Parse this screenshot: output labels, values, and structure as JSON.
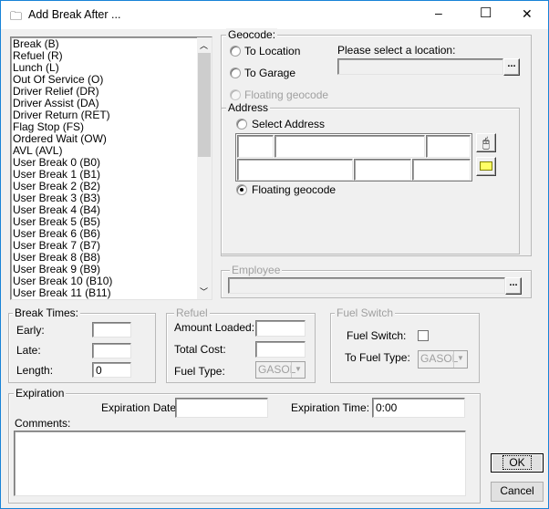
{
  "window": {
    "title": "Add Break After ...",
    "icon": "folder-window-icon",
    "minimize": "–",
    "maximize": "☐",
    "close": "✕"
  },
  "break_list": {
    "items": [
      "Break (B)",
      "Refuel (R)",
      "Lunch (L)",
      "Out Of Service (O)",
      "Driver Relief (DR)",
      "Driver Assist (DA)",
      "Driver Return (RET)",
      "Flag Stop (FS)",
      "Ordered Wait (OW)",
      "AVL (AVL)",
      "User Break 0 (B0)",
      "User Break 1 (B1)",
      "User Break 2 (B2)",
      "User Break 3 (B3)",
      "User Break 4 (B4)",
      "User Break 5 (B5)",
      "User Break 6 (B6)",
      "User Break 7 (B7)",
      "User Break 8 (B8)",
      "User Break 9 (B9)",
      "User Break 10 (B10)",
      "User Break 11 (B11)"
    ]
  },
  "geocode": {
    "legend": "Geocode:",
    "to_location": "To Location",
    "to_garage": "To Garage",
    "floating_geocode": "Floating geocode",
    "location_prompt": "Please select a location:",
    "location_value": "",
    "browse": "..."
  },
  "address": {
    "legend": "Address",
    "select_address": "Select Address",
    "floating_geocode": "Floating geocode",
    "selected": "floating_geocode"
  },
  "employee": {
    "legend": "Employee",
    "value": "",
    "browse": "..."
  },
  "break_times": {
    "legend": "Break Times:",
    "early_label": "Early:",
    "early": "",
    "late_label": "Late:",
    "late": "",
    "length_label": "Length:",
    "length": "0"
  },
  "refuel": {
    "legend": "Refuel",
    "amount_label": "Amount Loaded:",
    "amount": "",
    "cost_label": "Total Cost:",
    "cost": "",
    "fuel_type_label": "Fuel Type:",
    "fuel_type": "GASOL"
  },
  "fuel_switch": {
    "legend": "Fuel Switch",
    "switch_label": "Fuel Switch:",
    "switch_checked": false,
    "to_fuel_label": "To Fuel Type:",
    "to_fuel": "GASOL"
  },
  "expiration": {
    "legend": "Expiration",
    "date_label": "Expiration Date:",
    "date": "",
    "time_label": "Expiration Time:",
    "time": "0:00",
    "comments_label": "Comments:",
    "comments": ""
  },
  "buttons": {
    "ok": "OK",
    "cancel": "Cancel"
  }
}
